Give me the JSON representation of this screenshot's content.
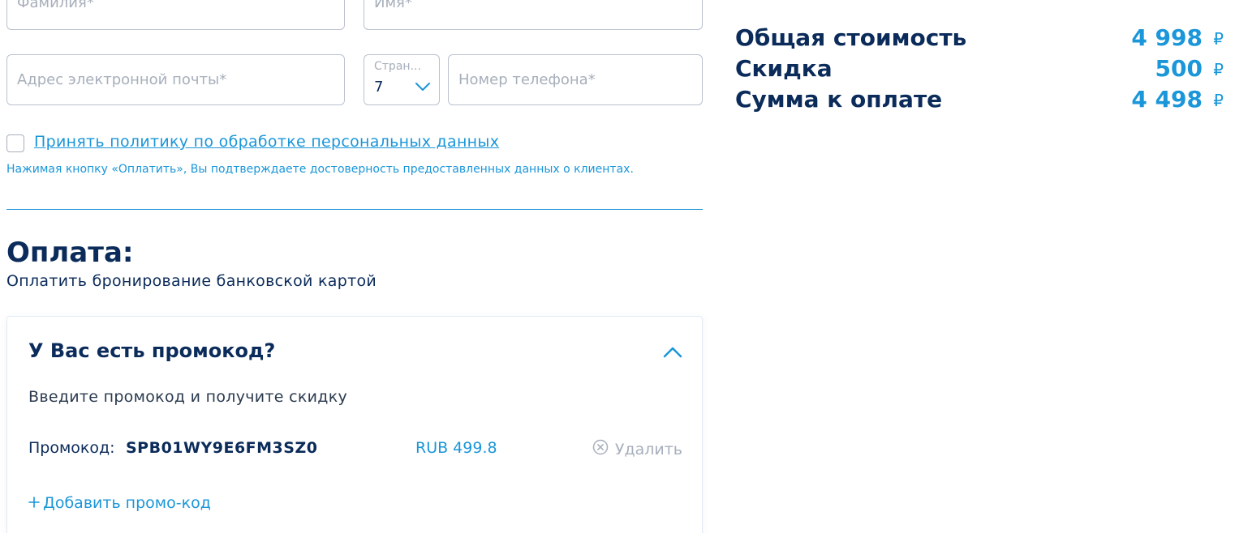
{
  "form": {
    "lastname_placeholder": "Фамилия*",
    "firstname_placeholder": "Имя*",
    "email_placeholder": "Адрес электронной почты*",
    "country_label": "Стран...",
    "country_code": "7",
    "phone_placeholder": "Номер телефона*"
  },
  "consent": {
    "policy_link": "Принять политику по обработке персональных данных",
    "note": "Нажимая кнопку «Оплатить», Вы подтверждаете достоверность предоставленных данных о клиентах."
  },
  "payment": {
    "title": "Оплата:",
    "subtitle": "Оплатить бронирование банковской картой"
  },
  "promo": {
    "question": "У Вас есть промокод?",
    "hint": "Введите промокод и получите скидку",
    "code_label": "Промокод:",
    "code_value": "SPB01WY9E6FM3SZ0",
    "amount": "RUB 499.8",
    "remove_label": "Удалить",
    "add_label": "Добавить промо-код"
  },
  "summary": {
    "total_label": "Общая стоимость",
    "total_value": "4 998",
    "discount_label": "Скидка",
    "discount_value": "500",
    "due_label": "Сумма к оплате",
    "due_value": "4 498",
    "currency": "₽"
  },
  "icons": {
    "chevron_down": "chevron-down-icon",
    "chevron_up": "chevron-up-icon",
    "remove": "circle-x-icon",
    "add": "plus-icon"
  },
  "colors": {
    "primary_dark": "#0b2b5a",
    "accent_blue": "#1a96d9",
    "placeholder_gray": "#a7afbb",
    "border_gray": "#b9c2cf"
  }
}
